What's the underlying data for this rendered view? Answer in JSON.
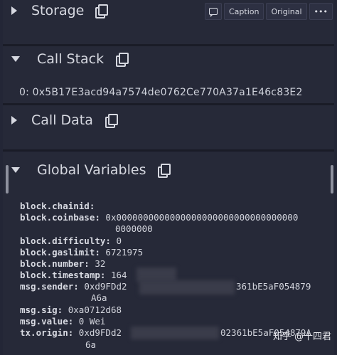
{
  "toolbar": {
    "comment_icon": "comment-icon",
    "caption": "Caption",
    "original": "Original",
    "more": "•••"
  },
  "sections": {
    "storage": {
      "title": "Storage"
    },
    "call_stack": {
      "title": "Call Stack",
      "entry": "0: 0x5B17E3acd94a7574de0762Ce770A37a1E46c83E2"
    },
    "call_data": {
      "title": "Call Data"
    },
    "global_variables": {
      "title": "Global Variables"
    }
  },
  "globals": {
    "chainid_key": "block.chainid:",
    "coinbase_key": "block.coinbase:",
    "coinbase_val1": "0x0000000000000000000000000000000000",
    "coinbase_val2": "0000000",
    "difficulty_key": "block.difficulty:",
    "difficulty_val": "0",
    "gaslimit_key": "block.gaslimit:",
    "gaslimit_val": "6721975",
    "number_key": "block.number:",
    "number_val": "32",
    "timestamp_key": "block.timestamp:",
    "timestamp_val": "164",
    "sender_key": "msg.sender:",
    "sender_val_start": "0xd9FDd2",
    "sender_val_end": "361bE5aF054879",
    "sender_val2": "A6a",
    "sig_key": "msg.sig:",
    "sig_val": "0xa0712d68",
    "value_key": "msg.value:",
    "value_val": "0 Wei",
    "origin_key": "tx.origin:",
    "origin_val_start": "0xd9FDd2",
    "origin_val_end": "02361bE5aF054879A",
    "origin_val2": "6a"
  },
  "watermark": {
    "text": "知乎 @十四君"
  }
}
